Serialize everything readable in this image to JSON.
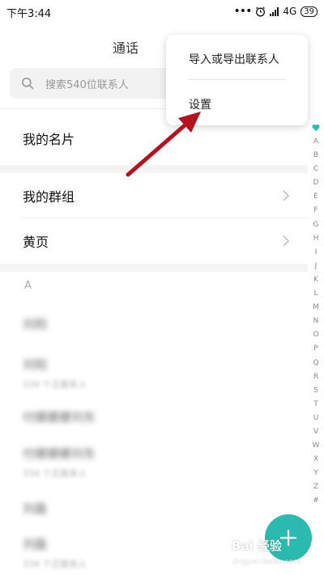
{
  "status_bar": {
    "time": "下午3:44",
    "dots": "•••",
    "network": "4G",
    "network_sub": "ll",
    "battery": "39"
  },
  "header": {
    "title": "通话"
  },
  "search": {
    "placeholder": "搜索540位联系人"
  },
  "sections": {
    "my_card": "我的名片",
    "my_groups": "我的群组",
    "yellow_pages": "黄页"
  },
  "contacts": {
    "section_letter": "A",
    "items": [
      {
        "name": "刘阳",
        "sub": ""
      },
      {
        "name": "刘阳",
        "sub": "334 个正联系人"
      },
      {
        "name": "付娜娜娜刘东",
        "sub": ""
      },
      {
        "name": "付娜娜娜刘东",
        "sub": "334 个正联系人"
      },
      {
        "name": "刘磊",
        "sub": ""
      },
      {
        "name": "刘磊",
        "sub": "334 个正联系人"
      }
    ]
  },
  "index_bar": [
    "A",
    "B",
    "C",
    "D",
    "E",
    "F",
    "G",
    "H",
    "I",
    "J",
    "K",
    "L",
    "M",
    "N",
    "O",
    "P",
    "Q",
    "R",
    "S",
    "T",
    "U",
    "V",
    "W",
    "X",
    "Y",
    "Z",
    "#"
  ],
  "popup_menu": {
    "import_export": "导入或导出联系人",
    "settings": "设置"
  },
  "watermark": {
    "text": "Bai 经验",
    "sub": "jingyan.baidu.com"
  },
  "colors": {
    "accent": "#2bb9b0",
    "arrow": "#b3121e"
  }
}
